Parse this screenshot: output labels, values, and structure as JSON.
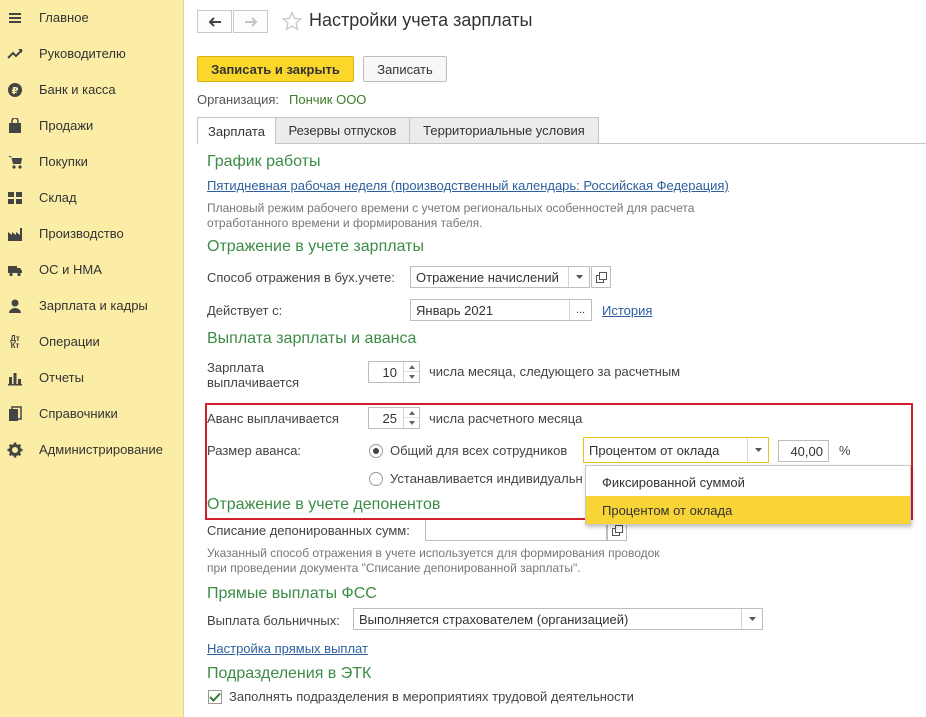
{
  "sidebar": {
    "items": [
      {
        "label": "Главное",
        "icon": "menu-icon"
      },
      {
        "label": "Руководителю",
        "icon": "trend-icon"
      },
      {
        "label": "Банк и касса",
        "icon": "ruble-icon"
      },
      {
        "label": "Продажи",
        "icon": "bag-icon"
      },
      {
        "label": "Покупки",
        "icon": "cart-icon"
      },
      {
        "label": "Склад",
        "icon": "grid-icon"
      },
      {
        "label": "Производство",
        "icon": "factory-icon"
      },
      {
        "label": "ОС и НМА",
        "icon": "truck-icon"
      },
      {
        "label": "Зарплата и кадры",
        "icon": "person-icon"
      },
      {
        "label": "Операции",
        "icon": "dt-kt-icon",
        "icon_text_top": "Дт",
        "icon_text_bottom": "Кт"
      },
      {
        "label": "Отчеты",
        "icon": "bar-chart-icon"
      },
      {
        "label": "Справочники",
        "icon": "books-icon"
      },
      {
        "label": "Администрирование",
        "icon": "gear-icon"
      }
    ]
  },
  "header": {
    "title": "Настройки учета зарплаты"
  },
  "toolbar": {
    "save_close_label": "Записать и закрыть",
    "save_label": "Записать"
  },
  "organization": {
    "label": "Организация:",
    "value": "Пончик ООО"
  },
  "tabs": [
    {
      "label": "Зарплата",
      "active": true
    },
    {
      "label": "Резервы отпусков",
      "active": false
    },
    {
      "label": "Территориальные условия",
      "active": false
    }
  ],
  "work_schedule": {
    "title": "График работы",
    "link": "Пятидневная рабочая неделя (производственный календарь: Российская Федерация)",
    "hint_line1": "Плановый режим рабочего времени с учетом региональных особенностей для расчета",
    "hint_line2": "отработанного времени и формирования табеля."
  },
  "accounting": {
    "title": "Отражение в учете зарплаты",
    "method_label": "Способ отражения в бух.учете:",
    "method_value": "Отражение начислений",
    "valid_from_label": "Действует с:",
    "valid_from_value": "Январь 2021",
    "dots": "...",
    "history_link": "История"
  },
  "payout": {
    "title": "Выплата зарплаты и аванса",
    "salary_label_line1": "Зарплата",
    "salary_label_line2": "выплачивается",
    "salary_day": "10",
    "salary_suffix": "числа месяца, следующего за расчетным",
    "advance_label": "Аванс выплачивается",
    "advance_day": "25",
    "advance_suffix": "числа расчетного месяца",
    "advance_size_label": "Размер аванса:",
    "radio_common": "Общий для всех сотрудников",
    "radio_individual": "Устанавливается индивидуально",
    "method_value": "Процентом от оклада",
    "percent_value": "40,00",
    "percent_sign": "%"
  },
  "popup": {
    "options": [
      {
        "label": "Фиксированной суммой",
        "selected": false
      },
      {
        "label": "Процентом от оклада",
        "selected": true
      }
    ]
  },
  "deponents": {
    "title": "Отражение в учете депонентов",
    "writeoff_label": "Списание депонированных сумм:",
    "writeoff_value": "",
    "hint_line1": "Указанный способ отражения в учете используется для формирования проводок",
    "hint_line2": "при проведении документа \"Списание депонированной зарплаты\"."
  },
  "fss": {
    "title": "Прямые выплаты ФСС",
    "sick_label": "Выплата больничных:",
    "sick_value": "Выполняется страхователем (организацией)",
    "settings_link": "Настройка прямых выплат"
  },
  "etk": {
    "title": "Подразделения в ЭТК",
    "checkbox_label": "Заполнять подразделения в мероприятиях трудовой деятельности",
    "checked": true
  },
  "colors": {
    "sidebar_bg": "#fbeda6",
    "primary_button": "#fbd72b",
    "section_title": "#3c8c46",
    "link": "#2d5f9e",
    "highlight_border": "#d0202e",
    "selected_option": "#f8d436"
  }
}
